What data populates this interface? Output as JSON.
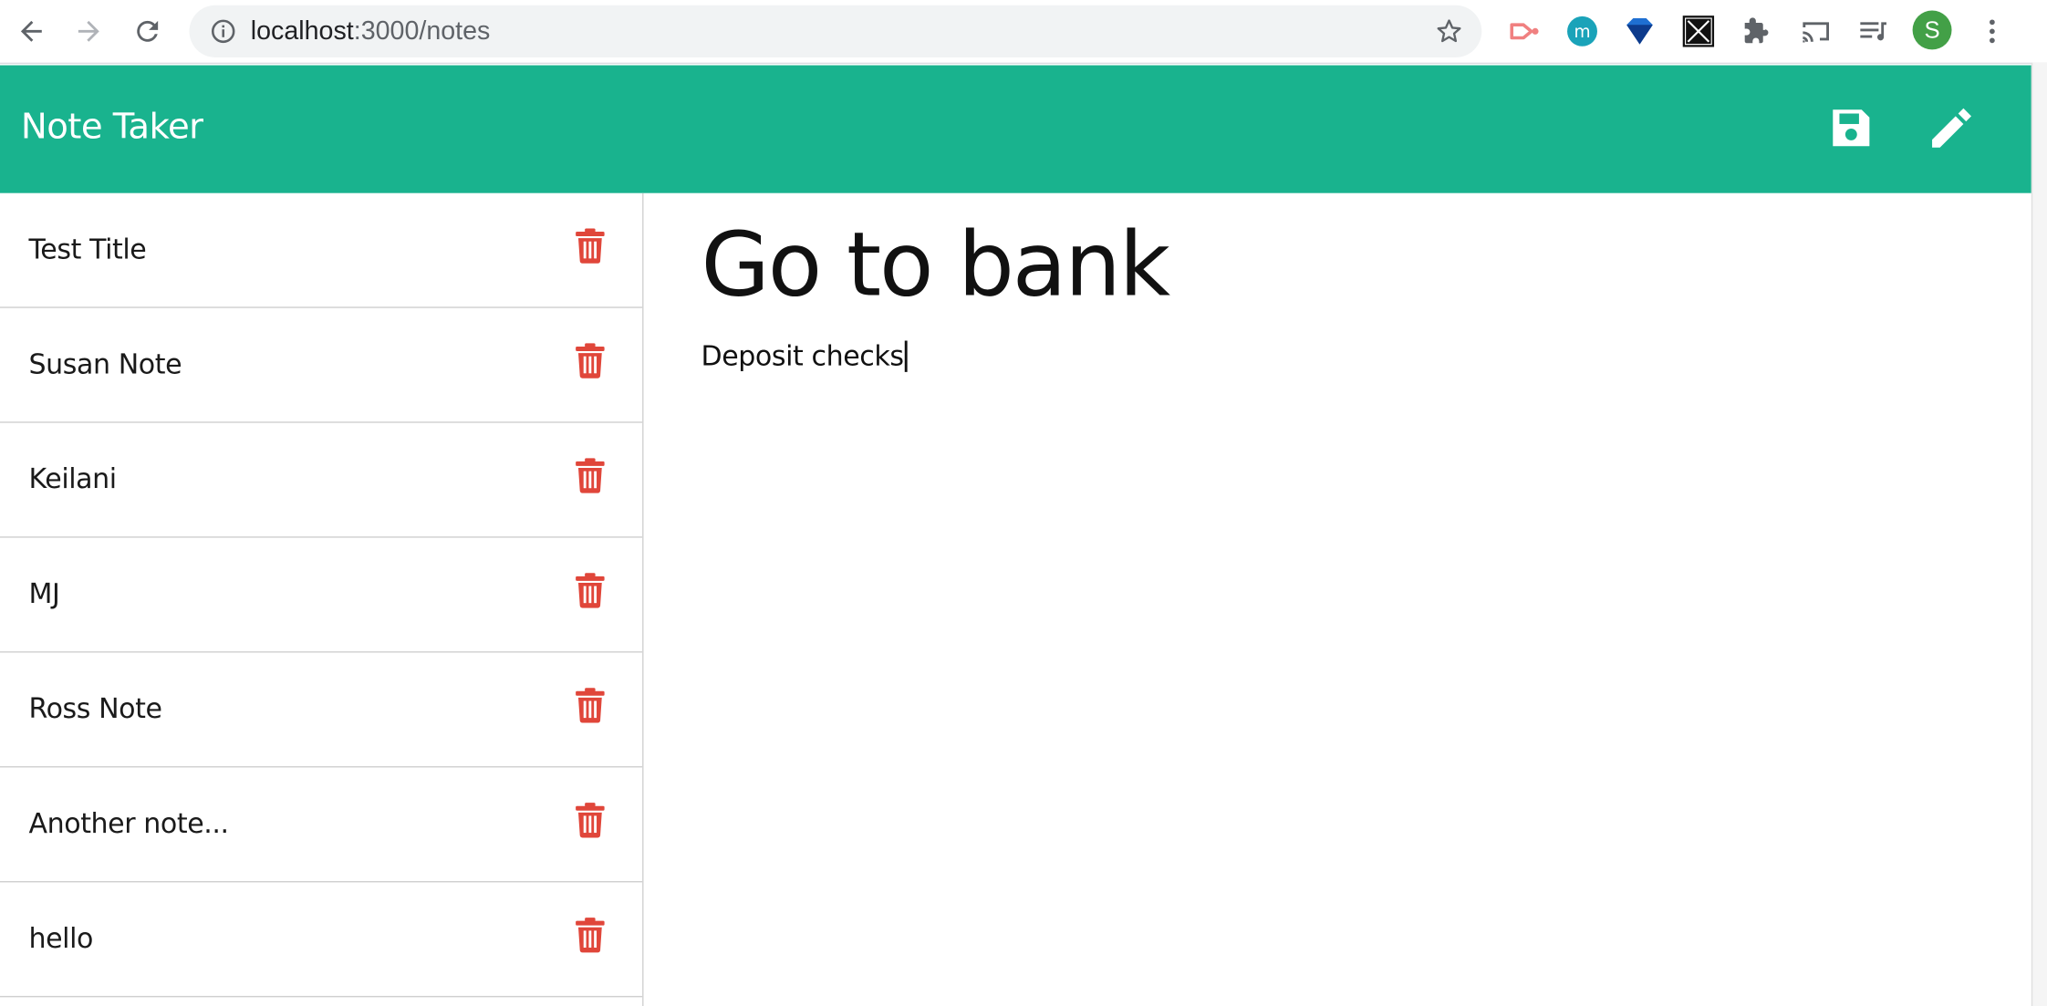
{
  "browser": {
    "url_host": "localhost",
    "url_path": ":3000/notes",
    "avatar_letter": "S",
    "extensions": [
      "record-icon",
      "m-extension-icon",
      "diamond-extension-icon",
      "x-extension-icon",
      "puzzle-icon",
      "cast-icon",
      "media-queue-icon"
    ]
  },
  "app": {
    "title": "Note Taker",
    "accent_color": "#19b38e",
    "delete_color": "#e0463a",
    "actions": [
      "save-icon",
      "pencil-icon"
    ]
  },
  "notes": [
    {
      "title": "Test Title"
    },
    {
      "title": "Susan Note"
    },
    {
      "title": "Keilani"
    },
    {
      "title": "MJ"
    },
    {
      "title": "Ross Note"
    },
    {
      "title": "Another note..."
    },
    {
      "title": "hello"
    }
  ],
  "active_note": {
    "title": "Go to bank",
    "text": "Deposit checks"
  }
}
